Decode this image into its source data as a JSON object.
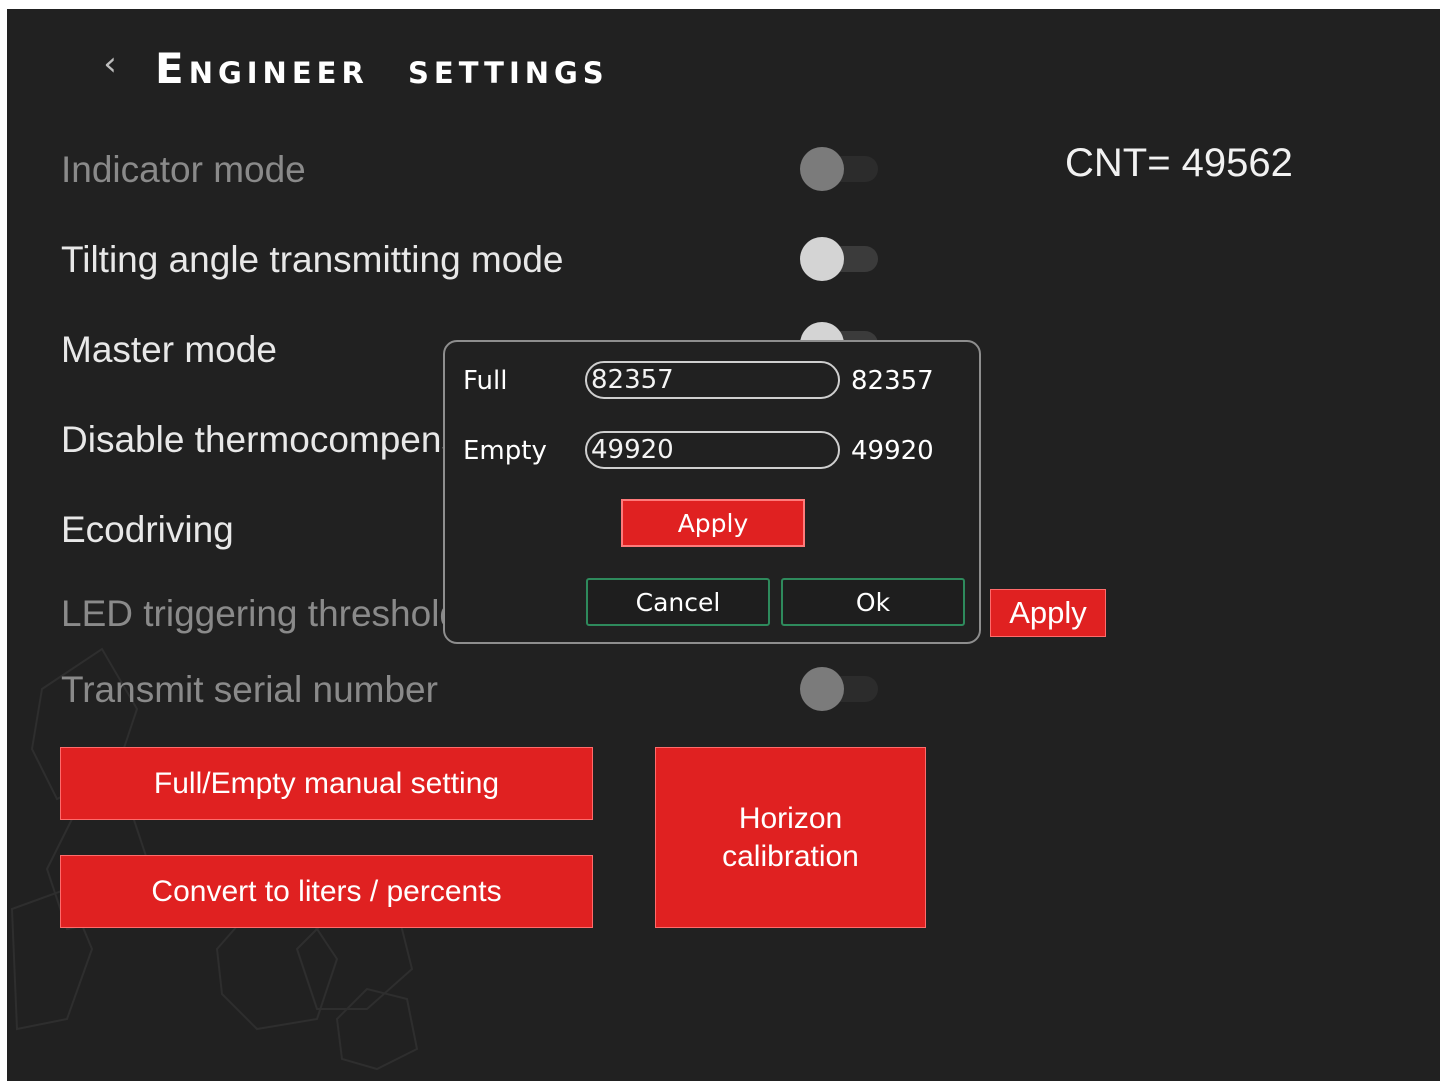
{
  "header": {
    "back_icon": "chevron-left-icon",
    "back_glyph": "‹",
    "title": "Engineer  settings"
  },
  "counter": {
    "text": "CNT= 49562"
  },
  "settings": [
    {
      "label": "Indicator mode",
      "enabled": false,
      "toggle_on": false
    },
    {
      "label": "Tilting angle transmitting mode",
      "enabled": true,
      "toggle_on": false
    },
    {
      "label": "Master mode",
      "enabled": true,
      "toggle_on": false
    },
    {
      "label": "Disable thermocompensation",
      "enabled": true
    },
    {
      "label": "Ecodriving",
      "enabled": true
    },
    {
      "label": "LED triggering threshold",
      "enabled": false
    },
    {
      "label": "Transmit serial number",
      "enabled": false,
      "toggle_on": false
    }
  ],
  "threshold_apply_label": "Apply",
  "buttons": {
    "full_empty": "Full/Empty manual setting",
    "convert": "Convert to liters / percents",
    "horizon": "Horizon calibration"
  },
  "dialog": {
    "full_label": "Full",
    "full_input": "82357",
    "full_value": "82357",
    "empty_label": "Empty",
    "empty_input": "49920",
    "empty_value": "49920",
    "apply_label": "Apply",
    "cancel_label": "Cancel",
    "ok_label": "Ok"
  },
  "colors": {
    "background": "#212121",
    "accent_red": "#e02121",
    "dialog_button_border": "#2e8a5c"
  }
}
